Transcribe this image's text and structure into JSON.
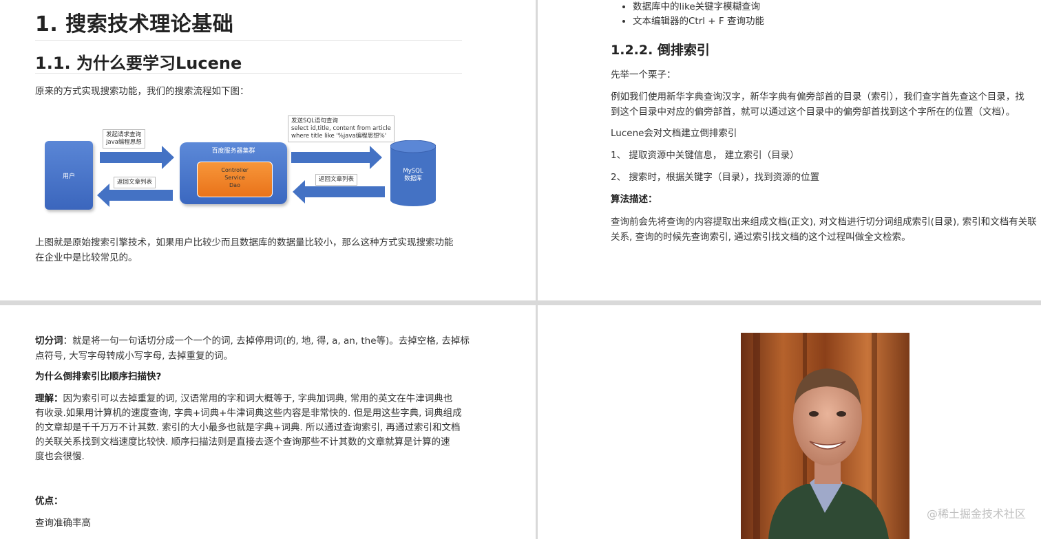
{
  "page1": {
    "h1": "1. 搜索技术理论基础",
    "h2": "1.1. 为什么要学习Lucene",
    "intro": "原来的方式实现搜索功能，我们的搜索流程如下图：",
    "diagram": {
      "user": "用户",
      "request_note_line1": "发起请求查询",
      "request_note_line2": "java编程思想",
      "server_title": "百度服务器集群",
      "layer1": "Controller",
      "layer2": "Service",
      "layer3": "Dao",
      "sql_note_line1": "发送SQL语句查询",
      "sql_note_line2": "select id,title, content  from  article",
      "sql_note_line3": "where  title  like  '%java编程思想%'",
      "return_note_left": "返回文章列表",
      "return_note_right": "返回文章列表",
      "db_line1": "MySQL",
      "db_line2": "数据库"
    },
    "summary_line1": "上图就是原始搜索引擎技术，如果用户比较少而且数据库的数据量比较小，那么这种方式实现搜索功能",
    "summary_line2": "在企业中是比较常见的。"
  },
  "page2": {
    "bullet1": "数据库中的like关键字模糊查询",
    "bullet2": "文本编辑器的Ctrl + F 查询功能",
    "h3": "1.2.2. 倒排索引",
    "example": "先举一个栗子：",
    "dict_line1": "例如我们使用新华字典查询汉字，新华字典有偏旁部首的目录（索引），我们查字首先查这个目录，找",
    "dict_line2": "到这个目录中对应的偏旁部首，就可以通过这个目录中的偏旁部首找到这个字所在的位置（文档）。",
    "lucene": "Lucene会对文档建立倒排索引",
    "step1": "1、 提取资源中关键信息， 建立索引（目录）",
    "step2": "2、 搜索时，根据关键字（目录），找到资源的位置",
    "algo_title": "算法描述：",
    "algo_line1": "查询前会先将查询的内容提取出来组成文档(正文), 对文档进行切分词组成索引(目录), 索引和文档有关联",
    "algo_line2": "关系, 查询的时候先查询索引, 通过索引找文档的这个过程叫做全文检索。"
  },
  "page3": {
    "seg_label": "切分词",
    "seg_line1": "：就是将一句一句话切分成一个一个的词, 去掉停用词(的, 地, 得, a, an, the等)。去掉空格, 去掉标",
    "seg_line2": "点符号, 大写字母转成小写字母, 去掉重复的词。",
    "question": "为什么倒排索引比顺序扫描快?",
    "understand_label": "理解：",
    "understand_line1": "因为索引可以去掉重复的词, 汉语常用的字和词大概等于, 字典加词典, 常用的英文在牛津词典也",
    "understand_line2": "有收录.如果用计算机的速度查询, 字典+词典+牛津词典这些内容是非常快的. 但是用这些字典, 词典组成",
    "understand_line3": "的文章却是千千万万不计其数. 索引的大小最多也就是字典+词典. 所以通过查询索引, 再通过索引和文档",
    "understand_line4": "的关联关系找到文档速度比较快. 顺序扫描法则是直接去逐个查询那些不计其数的文章就算是计算的速",
    "understand_line5": "度也会很慢.",
    "advantage_title": "优点：",
    "advantage_text": "查询准确率高"
  },
  "page4": {
    "watermark": "@稀土掘金技术社区"
  }
}
